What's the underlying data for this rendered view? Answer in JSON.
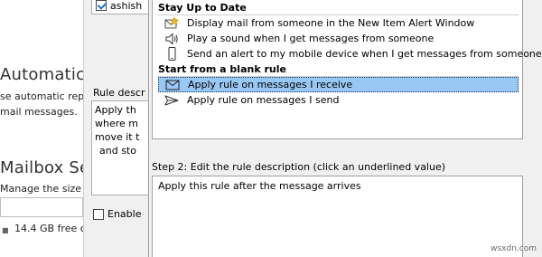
{
  "background_page": {
    "heading_automatic": "Automatic I",
    "automatic_line1": "se automatic rep",
    "automatic_line2": "mail messages.",
    "heading_mailbox": "Mailbox Set",
    "mailbox_line": "Manage the size c",
    "mailbox_size": "14.4 GB free o"
  },
  "rules_dialog": {
    "rule_list_item": "ashish",
    "rule_description_label": "Rule descr",
    "description_lines": [
      "Apply th",
      "where m",
      "move it t",
      "and sto"
    ],
    "enable_label": "Enable"
  },
  "wizard": {
    "groups": [
      {
        "heading": "Stay Up to Date",
        "items": [
          {
            "icon": "mail-alert-icon",
            "label": "Display mail from someone in the New Item Alert Window",
            "selected": false
          },
          {
            "icon": "speaker-icon",
            "label": "Play a sound when I get messages from someone",
            "selected": false
          },
          {
            "icon": "mobile-device-icon",
            "label": "Send an alert to my mobile device when I get messages from someone",
            "selected": false
          }
        ]
      },
      {
        "heading": "Start from a blank rule",
        "items": [
          {
            "icon": "envelope-icon",
            "label": "Apply rule on messages I receive",
            "selected": true
          },
          {
            "icon": "send-arrow-icon",
            "label": "Apply rule on messages I send",
            "selected": false
          }
        ]
      }
    ],
    "step2_label": "Step 2: Edit the rule description (click an underlined value)",
    "rule_description": "Apply this rule after the message arrives"
  },
  "watermark": "wsxdn.com",
  "colors": {
    "selection": "#99c8f5",
    "panel": "#ffffff",
    "dialog": "#f0f0f0"
  }
}
